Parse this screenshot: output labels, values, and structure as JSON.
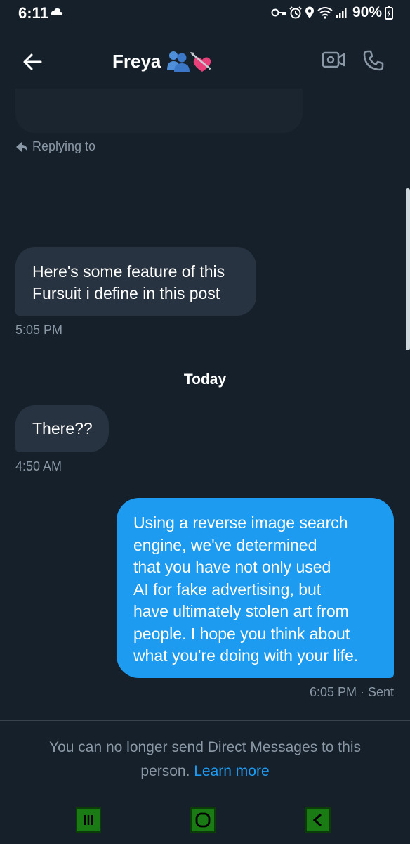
{
  "status_bar": {
    "time": "6:11",
    "battery": "90%",
    "icons": [
      "cloud-icon",
      "vpn-key-icon",
      "alarm-icon",
      "location-icon",
      "wifi-icon",
      "signal-icon",
      "battery-charging-icon"
    ]
  },
  "header": {
    "contact_name": "Freya",
    "icons": [
      "back-arrow-icon",
      "couple-emoji-icon",
      "heart-arrow-emoji-icon",
      "video-call-icon",
      "phone-icon"
    ]
  },
  "conversation": {
    "replying_to": "Replying to",
    "messages": [
      {
        "direction": "incoming",
        "lines": [
          "Here's some feature of this",
          "Fursuit i define in this post"
        ],
        "time": "5:05 PM"
      },
      {
        "direction": "incoming",
        "lines": [
          "There??"
        ],
        "time": "4:50 AM"
      },
      {
        "direction": "outgoing",
        "lines": [
          "Using a reverse image search",
          "engine, we've determined",
          "that you have not only used",
          "AI for fake advertising, but",
          "have ultimately stolen art from",
          "people. I hope you think about",
          "what you're doing with your life."
        ],
        "time": "6:05 PM · Sent"
      }
    ],
    "day_divider": "Today"
  },
  "footer": {
    "notice_line1": "You can no longer send Direct Messages to this",
    "notice_line2": "person.",
    "learn_more": "Learn more"
  },
  "colors": {
    "background": "#15202b",
    "incoming_bubble": "#273340",
    "outgoing_bubble": "#1d9bf0",
    "muted_text": "#8b98a5",
    "nav_button": "#1a7a14"
  }
}
